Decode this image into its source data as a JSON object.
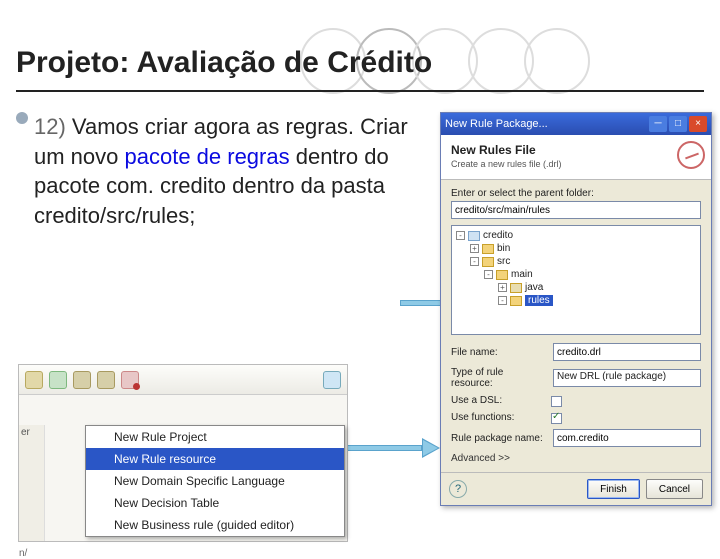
{
  "slide": {
    "title": "Projeto: Avaliação de Crédito",
    "bullet_number": "12)",
    "text_lead": "Vamos criar agora as regras. ",
    "text_after_highlight": " dentro do pacote com. credito dentro da pasta credito/src/rules;",
    "text_criar": "Criar um novo ",
    "highlight": "pacote de regras"
  },
  "context_menu": {
    "side_label_top": "er",
    "side_label_bottom": "n/",
    "items": [
      "New Rule Project",
      "New Rule resource",
      "New Domain Specific Language",
      "New Decision Table",
      "New Business rule (guided editor)"
    ],
    "selected_index": 1
  },
  "wizard": {
    "title": "New Rule Package...",
    "header_title": "New Rules File",
    "header_subtitle": "Create a new rules file (.drl)",
    "parent_label": "Enter or select the parent folder:",
    "parent_value": "credito/src/main/rules",
    "tree": [
      {
        "level": 0,
        "toggle": "-",
        "type": "prj",
        "name": "credito"
      },
      {
        "level": 1,
        "toggle": "+",
        "type": "fldr",
        "name": "bin"
      },
      {
        "level": 1,
        "toggle": "-",
        "type": "fldr",
        "name": "src"
      },
      {
        "level": 2,
        "toggle": "-",
        "type": "fldr",
        "name": "main"
      },
      {
        "level": 3,
        "toggle": "+",
        "type": "pkg",
        "name": "java"
      },
      {
        "level": 3,
        "toggle": "-",
        "type": "fldr",
        "name": "rules",
        "selected": true
      }
    ],
    "filename_label": "File name:",
    "filename_value": "credito.drl",
    "type_label": "Type of rule resource:",
    "type_value": "New DRL (rule package)",
    "use_dsl_label": "Use a DSL:",
    "use_functions_label": "Use functions:",
    "package_label": "Rule package name:",
    "package_value": "com.credito",
    "advanced": "Advanced >>",
    "finish": "Finish",
    "cancel": "Cancel",
    "minimize": "─",
    "maximize": "□",
    "close": "×",
    "help": "?"
  }
}
